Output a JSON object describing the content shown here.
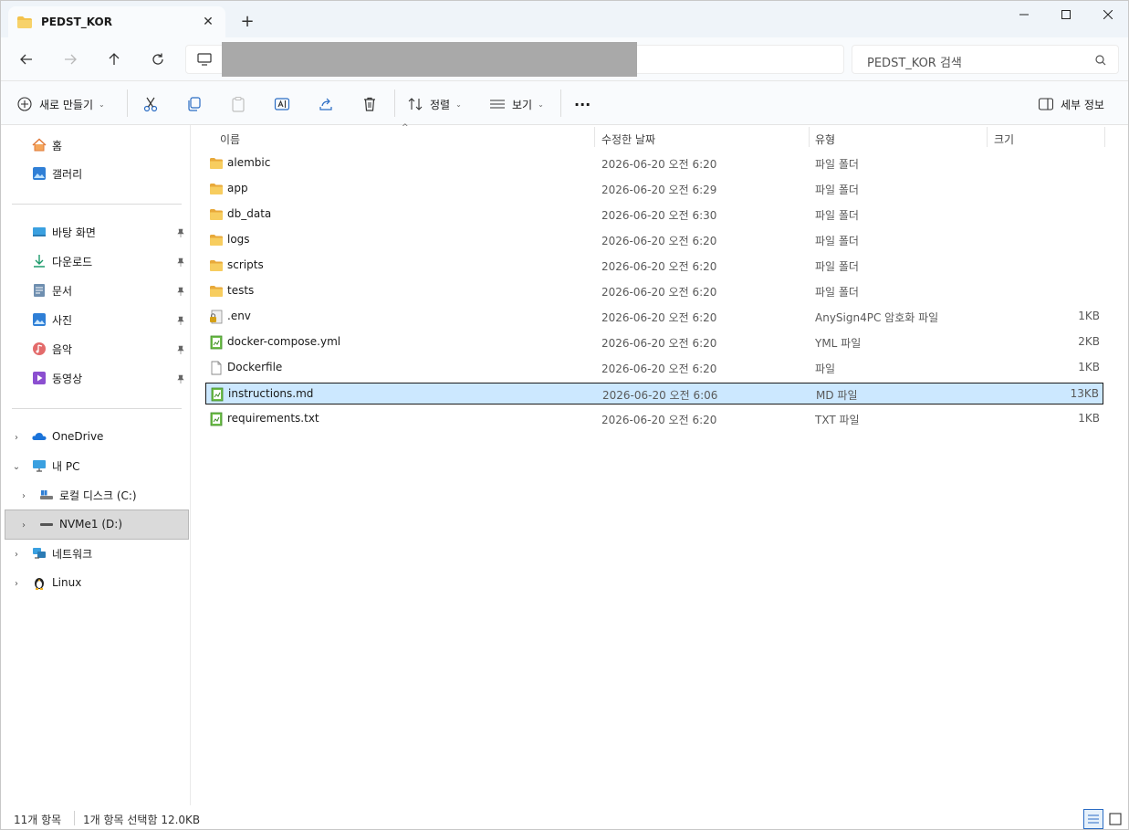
{
  "tab": {
    "title": "PEDST_KOR",
    "close_label": "✕",
    "new_label": "+"
  },
  "window_controls": {
    "minimize": "—",
    "maximize": "☐",
    "close": "✕"
  },
  "address": {
    "search_placeholder": "PEDST_KOR 검색"
  },
  "commands": {
    "new": "새로 만들기",
    "sort": "정렬",
    "view": "보기",
    "more": "···",
    "details": "세부 정보"
  },
  "sidebar": {
    "home": "홈",
    "gallery": "갤러리",
    "quick": [
      {
        "label": "바탕 화면",
        "icon": "desktop-icon"
      },
      {
        "label": "다운로드",
        "icon": "download-icon"
      },
      {
        "label": "문서",
        "icon": "document-icon"
      },
      {
        "label": "사진",
        "icon": "picture-icon"
      },
      {
        "label": "음악",
        "icon": "music-icon"
      },
      {
        "label": "동영상",
        "icon": "video-icon"
      }
    ],
    "onedrive": "OneDrive",
    "thispc": "내 PC",
    "drive_c": "로컬 디스크 (C:)",
    "drive_d": "NVMe1 (D:)",
    "network": "네트워크",
    "linux": "Linux"
  },
  "columns": {
    "name": "이름",
    "date": "수정한 날짜",
    "type": "유형",
    "size": "크기"
  },
  "files": [
    {
      "name": "alembic",
      "date": "2026-06-20 오전 6:20",
      "type": "파일 폴더",
      "size": "",
      "icon": "folder-icon"
    },
    {
      "name": "app",
      "date": "2026-06-20 오전 6:29",
      "type": "파일 폴더",
      "size": "",
      "icon": "folder-icon"
    },
    {
      "name": "db_data",
      "date": "2026-06-20 오전 6:30",
      "type": "파일 폴더",
      "size": "",
      "icon": "folder-icon"
    },
    {
      "name": "logs",
      "date": "2026-06-20 오전 6:20",
      "type": "파일 폴더",
      "size": "",
      "icon": "folder-icon"
    },
    {
      "name": "scripts",
      "date": "2026-06-20 오전 6:20",
      "type": "파일 폴더",
      "size": "",
      "icon": "folder-icon"
    },
    {
      "name": "tests",
      "date": "2026-06-20 오전 6:20",
      "type": "파일 폴더",
      "size": "",
      "icon": "folder-icon"
    },
    {
      "name": ".env",
      "date": "2026-06-20 오전 6:20",
      "type": "AnySign4PC 암호화 파일",
      "size": "1KB",
      "icon": "lock-file-icon"
    },
    {
      "name": "docker-compose.yml",
      "date": "2026-06-20 오전 6:20",
      "type": "YML 파일",
      "size": "2KB",
      "icon": "text-file-icon"
    },
    {
      "name": "Dockerfile",
      "date": "2026-06-20 오전 6:20",
      "type": "파일",
      "size": "1KB",
      "icon": "blank-file-icon"
    },
    {
      "name": "instructions.md",
      "date": "2026-06-20 오전 6:06",
      "type": "MD 파일",
      "size": "13KB",
      "icon": "text-file-icon",
      "selected": true
    },
    {
      "name": "requirements.txt",
      "date": "2026-06-20 오전 6:20",
      "type": "TXT 파일",
      "size": "1KB",
      "icon": "text-file-icon"
    }
  ],
  "status": {
    "count": "11개 항목",
    "selection": "1개 항목 선택함 12.0KB"
  },
  "colors": {
    "selection": "#cce8ff",
    "accent": "#2a6cc4",
    "folder": "#f3c24b"
  }
}
